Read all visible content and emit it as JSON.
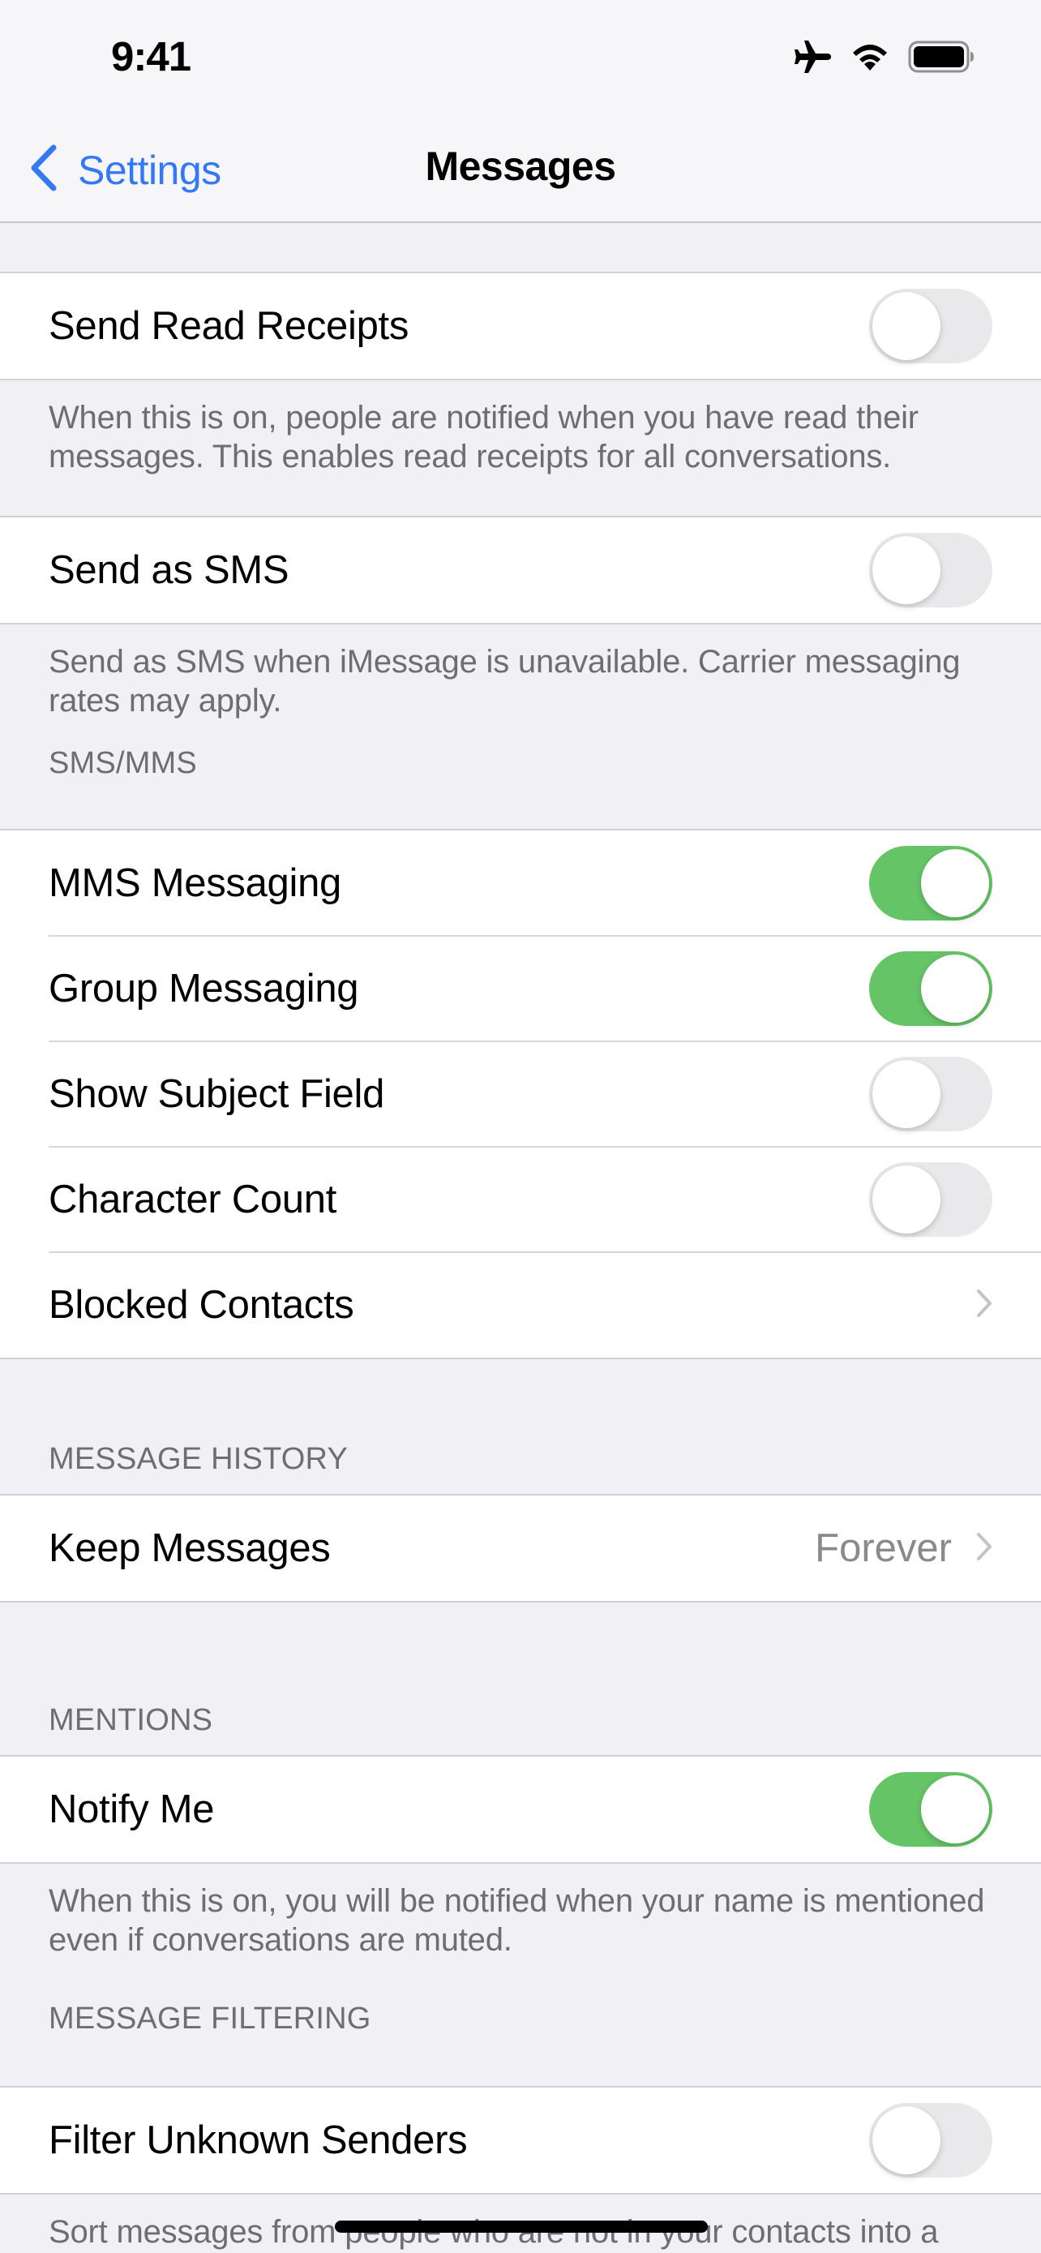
{
  "status_bar": {
    "time": "9:41",
    "icons": [
      "airplane-icon",
      "wifi-icon",
      "battery-icon"
    ]
  },
  "nav": {
    "back_label": "Settings",
    "title": "Messages"
  },
  "colors": {
    "accent": "#3478f6",
    "toggle_on": "#65c466",
    "toggle_off": "#e9e9eb",
    "background": "#f0f0f5"
  },
  "sections": {
    "read_receipts": {
      "row": {
        "label": "Send Read Receipts",
        "toggle": false
      },
      "footer": "When this is on, people are notified when you have read their messages. This enables read receipts for all conversations."
    },
    "send_sms": {
      "row": {
        "label": "Send as SMS",
        "toggle": false
      },
      "footer": "Send as SMS when iMessage is unavailable. Carrier messaging rates may apply."
    },
    "sms_mms": {
      "header": "SMS/MMS",
      "rows": [
        {
          "label": "MMS Messaging",
          "toggle": true
        },
        {
          "label": "Group Messaging",
          "toggle": true
        },
        {
          "label": "Show Subject Field",
          "toggle": false
        },
        {
          "label": "Character Count",
          "toggle": false
        },
        {
          "label": "Blocked Contacts",
          "disclosure": true
        }
      ]
    },
    "message_history": {
      "header": "MESSAGE HISTORY",
      "row": {
        "label": "Keep Messages",
        "value": "Forever",
        "disclosure": true
      }
    },
    "mentions": {
      "header": "MENTIONS",
      "row": {
        "label": "Notify Me",
        "toggle": true
      },
      "footer": "When this is on, you will be notified when your name is mentioned even if conversations are muted."
    },
    "message_filtering": {
      "header": "MESSAGE FILTERING",
      "row": {
        "label": "Filter Unknown Senders",
        "toggle": false
      },
      "footer": "Sort messages from people who are not in your contacts into a"
    }
  }
}
